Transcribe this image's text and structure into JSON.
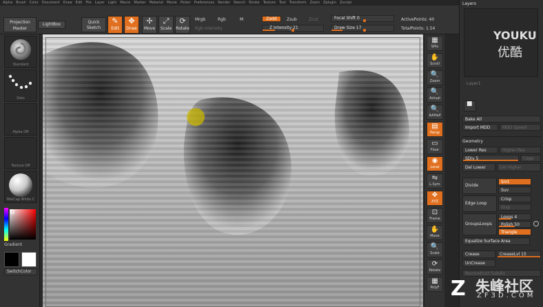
{
  "menu": [
    "Alpha",
    "Brush",
    "Color",
    "Document",
    "Draw",
    "Edit",
    "File",
    "Layer",
    "Light",
    "Macro",
    "Marker",
    "Material",
    "Movie",
    "Picker",
    "Preferences",
    "Render",
    "Stencil",
    "Stroke",
    "Texture",
    "Tool",
    "Transform",
    "Zoom",
    "Zplugin",
    "Zscript"
  ],
  "toolbar": {
    "projection_master": "Projection Master",
    "lightbox": "LightBox",
    "quick_sketch": "Quick Sketch",
    "edit": "Edit",
    "draw": "Draw",
    "move": "Move",
    "scale": "Scale",
    "rotate": "Rotate",
    "mrgb": "Mrgb",
    "rgb": "Rgb",
    "m": "M",
    "rgb_intensity": "Rgb Intensity",
    "zadd": "Zadd",
    "zsub": "Zsub",
    "zcut": "Zcut",
    "z_intensity": "Z Intensity 21",
    "focal_shift": "Focal Shift 0",
    "draw_size": "Draw Size 17",
    "active_points": "ActivePoints: 40",
    "total_points": "TotalPoints: 1.54"
  },
  "leftshelf": {
    "brush_label": "Standard",
    "stroke_label": "Dots",
    "alpha_label": "Alpha Off",
    "texture_label": "Texture Off",
    "material_label": "MatCap White C",
    "gradient_label": "Gradient",
    "switchcolor_label": "SwitchColor"
  },
  "rightshelf": [
    {
      "name": "spix",
      "label": "SPix",
      "icon": "▦"
    },
    {
      "name": "scroll",
      "label": "Scroll",
      "icon": "✋"
    },
    {
      "name": "zoom",
      "label": "Zoom",
      "icon": "🔍"
    },
    {
      "name": "actual",
      "label": "Actual",
      "icon": "🔍"
    },
    {
      "name": "aahalf",
      "label": "AAHalf",
      "icon": "🔍"
    },
    {
      "name": "persp",
      "label": "Persp",
      "icon": "▤"
    },
    {
      "name": "floor",
      "label": "Floor",
      "icon": "▭"
    },
    {
      "name": "local",
      "label": "Local",
      "icon": "◉"
    },
    {
      "name": "lsym",
      "label": "L.Sym",
      "icon": "⇋"
    },
    {
      "name": "xyz",
      "label": "XYZ",
      "icon": "✥"
    },
    {
      "name": "frame",
      "label": "Frame",
      "icon": "⊡"
    },
    {
      "name": "move",
      "label": "Move",
      "icon": "✋"
    },
    {
      "name": "scale",
      "label": "Scale",
      "icon": "🔍"
    },
    {
      "name": "rotate",
      "label": "Rotate",
      "icon": "⟳"
    },
    {
      "name": "polyf",
      "label": "PolyF",
      "icon": "▦"
    }
  ],
  "palette": {
    "layers_title": "Layers",
    "layer_name": "Layer1",
    "bake_all": "Bake All",
    "import_mdd": "Import MDD",
    "mdd_speed": "MDD Speed",
    "geometry_title": "Geometry",
    "lower_res": "Lower Res",
    "higher_res": "Higher Res",
    "sdiv": "SDiv 5",
    "cage": "Cage",
    "del_lower": "Del Lower",
    "del_higher": "Del Higher",
    "divide": "Divide",
    "smt": "Smt",
    "suv": "Suv",
    "edge_loop": "Edge Loop",
    "crisp": "Crisp",
    "disp": "Disp",
    "grouploops": "GroupsLoops",
    "loops": "Loops 4",
    "polish": "Polish 50",
    "triangle": "Triangle",
    "equalize": "Equalize Surface Area",
    "crease": "Crease",
    "creaselvl": "CreaseLvl 15",
    "uncrease": "UnCrease",
    "reconstruct": "Reconstruct Subdiv"
  },
  "watermarks": {
    "youku_en": "YOUKU",
    "youku_cn": "优酷",
    "zf3d_cn": "朱峰社区",
    "zf3d_url": "ZF3D.COM"
  },
  "colors": {
    "accent": "#e0701f",
    "panel": "#333333"
  }
}
